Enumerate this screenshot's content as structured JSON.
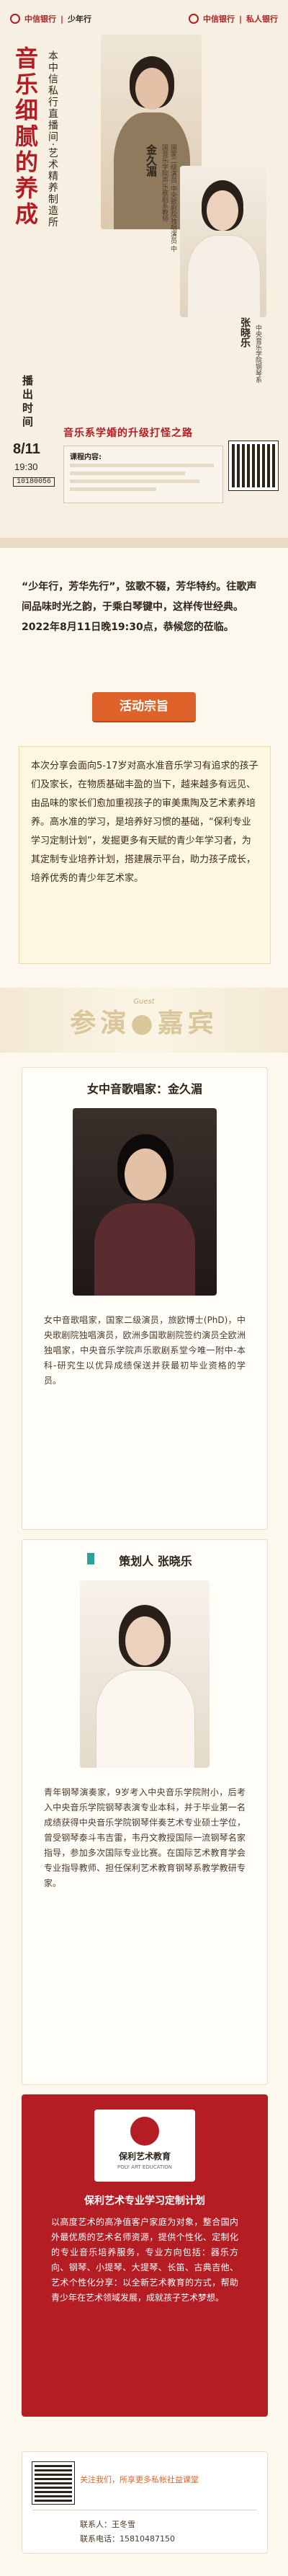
{
  "header": {
    "bank_brand": "中信银行",
    "youth_brand": "少年行",
    "private_bank": "私人银行"
  },
  "poster": {
    "title_main": "音乐细腻的养成",
    "title_sub": "本中信私行直播间·艺术精养制造所",
    "guest1_name": "金久湄",
    "guest1_title": "国家二级演员 中央歌剧院独唱演员 中国音乐学院声乐歌剧系教师",
    "guest2_name": "张晓乐",
    "guest2_title": "中央音乐学院钢琴系",
    "time_label": "播出时间",
    "date": "8/11",
    "clock": "19:30",
    "room_id": "10180056",
    "topic": "音乐系学婚的升级打怪之路",
    "content_label": "课程内容:"
  },
  "intro": {
    "lead": "“少年行，芳华先行”，弦歌不辍，芳华特约。往歌声间品味时光之韵，于乘白琴键中，这样传世经典。2022年8月11日晚19:30点，恭候您的莅临。",
    "section_title": "活动宗旨",
    "body": "本次分享会面向5-17岁对高水准音乐学习有追求的孩子们及家长，在物质基础丰盈的当下，越来越多有远见、由品味的家长们愈加重视孩子的审美熏陶及艺术素养培养。高水准的学习，是培养好习惯的基础，“保利专业学习定制计划”，发掘更多有天赋的青少年学习者，为其定制专业培养计划，搭建展示平台，助力孩子成长，培养优秀的青少年艺术家。"
  },
  "guests_banner": {
    "title": "参演●嘉宾",
    "sub": "Guest"
  },
  "guest1": {
    "heading": "女中音歌唱家：金久湄",
    "bio": "女中音歌唱家，国家二级演员，旅欧博士(PhD)，中央歌剧院独唱演员，欧洲多国歌剧院签约演员全欧洲独唱家，中央音乐学院声乐歌剧系堂今唯一附中-本科-研究生以优异成绩保送并获最初毕业资格的学员。"
  },
  "guest2": {
    "heading": "策划人 张晓乐",
    "bio": "青年钢琴演奏家，9岁考入中央音乐学院附小，后考入中央音乐学院钢琴表演专业本科，并于毕业第一名成绩获得中央音乐学院钢琴伴奏艺术专业硕士学位，曾受钢琴泰斗韦吉雷，韦丹文教授国际一流钢琴名家指导，参加多次国际专业比赛。在国际艺术教育学会专业指导教师、担任保利艺术教育钢琴系教学教研专家。"
  },
  "plan": {
    "logo_caption": "保利艺术教育",
    "logo_sub": "POLY ART EDUCATION",
    "heading": "保利艺术专业学习定制计划",
    "bio": "以高度艺术的高净值客户家庭为对象，整合国内外最优质的艺术名师资源，提供个性化、定制化的专业音乐培养服务，专业方向包括：器乐方向、钢琴、小提琴、大提琴、长笛、古典吉他、艺术个性化分享：以全新艺术教育的方式，帮助青少年在艺术领域发展，成就孩子艺术梦想。"
  },
  "footer": {
    "follow_text": "关注我们，所享更多私帐社益课堂",
    "contact_label": "联系人：王冬雪",
    "phone_label": "联系电话：15810487150"
  },
  "colors": {
    "accent": "#e0622b",
    "brand_red": "#b31d23",
    "gold": "#b89060",
    "teal": "#2aa39a"
  }
}
